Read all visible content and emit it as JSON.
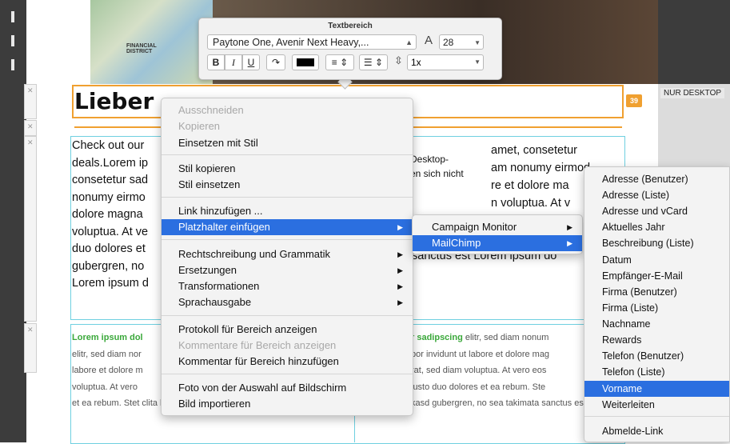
{
  "toolbar": {
    "title": "Textbereich",
    "font_family": "Paytone One, Avenir Next Heavy,...",
    "font_size": "28",
    "bold_label": "B",
    "italic_label": "I",
    "underline_label": "U",
    "line_height": "1x",
    "text_color": "#000000"
  },
  "canvas": {
    "headline": "Lieber",
    "badge": "39",
    "desktop_label": "NUR DESKTOP",
    "map_label": "FINANCIAL DISTRICT",
    "body_lines": [
      "Check out our",
      "deals.Lorem ip",
      "consetetur sad",
      "nonumy eirmo",
      "dolore magna",
      "voluptua. At ve",
      "duo dolores et",
      "gubergren, no",
      "Lorem ipsum d"
    ],
    "right_lines": [
      "amet, consetetur",
      "am nonumy eirmod",
      "re et dolore ma",
      "n voluptua. At v",
      "",
      "",
      "sanctus est Lorem ipsum do"
    ],
    "hidden_note_lines": [
      "Desktop-",
      "en sich nicht"
    ],
    "green_left": {
      "heading": "Lorem ipsum dol",
      "lines": [
        "elitr, sed diam nor",
        "labore et dolore m",
        "voluptua. At vero",
        "et ea rebum. Stet clita kasd gubergren, no sea"
      ]
    },
    "green_right": {
      "heading": "r sadipscing",
      "heading_rest": " elitr, sed diam nonum",
      "lines": [
        "por invidunt ut labore et dolore mag",
        "rat, sed diam voluptua. At vero eos",
        "justo duo dolores et ea rebum. Ste",
        "kasd gubergren, no sea takimata sanctus est L"
      ]
    }
  },
  "context_menu": {
    "items": [
      {
        "label": "Ausschneiden",
        "disabled": true
      },
      {
        "label": "Kopieren",
        "disabled": true
      },
      {
        "label": "Einsetzen mit Stil",
        "disabled": false
      },
      {
        "label": "Stil kopieren",
        "disabled": false
      },
      {
        "label": "Stil einsetzen",
        "disabled": false
      },
      {
        "label": "Link hinzufügen ...",
        "disabled": false
      },
      {
        "label": "Platzhalter einfügen",
        "disabled": false
      },
      {
        "label": "Rechtschreibung und Grammatik",
        "disabled": false
      },
      {
        "label": "Ersetzungen",
        "disabled": false
      },
      {
        "label": "Transformationen",
        "disabled": false
      },
      {
        "label": "Sprachausgabe",
        "disabled": false
      },
      {
        "label": "Protokoll für Bereich anzeigen",
        "disabled": false
      },
      {
        "label": "Kommentare für Bereich anzeigen",
        "disabled": true
      },
      {
        "label": "Kommentar für Bereich hinzufügen",
        "disabled": false
      },
      {
        "label": "Foto von der Auswahl auf Bildschirm",
        "disabled": false
      },
      {
        "label": "Bild importieren",
        "disabled": false
      }
    ]
  },
  "submenu_placeholder": {
    "items": [
      "Campaign Monitor",
      "MailChimp"
    ]
  },
  "submenu_mailchimp": {
    "items": [
      "Adresse (Benutzer)",
      "Adresse (Liste)",
      "Adresse und vCard",
      "Aktuelles Jahr",
      "Beschreibung (Liste)",
      "Datum",
      "Empfänger-E-Mail",
      "Firma (Benutzer)",
      "Firma (Liste)",
      "Nachname",
      "Rewards",
      "Telefon (Benutzer)",
      "Telefon (Liste)",
      "Vorname",
      "Weiterleiten",
      "Abmelde-Link"
    ]
  },
  "colors": {
    "accent": "#2b6fe0",
    "highlight_orange": "#f0a030",
    "guide_cyan": "#6fd0e0",
    "green_text": "#3aa83a"
  }
}
